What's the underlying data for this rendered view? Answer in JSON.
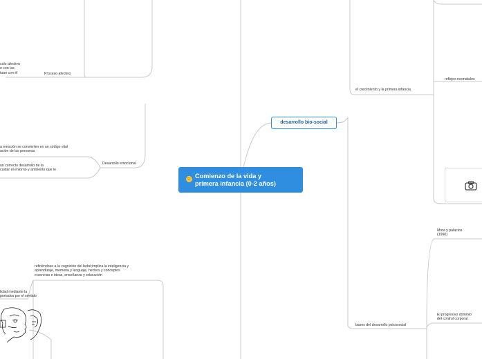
{
  "root": {
    "emoji": "😊",
    "label": "Comienzo de la vida y\nprimera infancia (0-2 años)"
  },
  "branches": {
    "desarrollo_bio_social": {
      "label": "desarrollo bio-social",
      "children": {
        "crecimiento": {
          "label": "el crecimiento y la primera infancia",
          "reflejos": "reflejos neonatales"
        },
        "bases": {
          "label": "bases del desarrollo psicosocial",
          "mora": "Mora y palacios\n (1990)",
          "progresivo": "El progresivo dominio\ndel control corporal"
        }
      }
    },
    "proceso_afectivo": {
      "label": "Proceso afectivo",
      "detail": "culo afectivo\no con las\ntuan con él"
    },
    "desarrollo_emocional": {
      "label": "Desarrollo emocional",
      "detail1": "a emoción se convierten en un código vital\nación de las personas",
      "detail2": "un correcto desarrollo de la\ncuidar el entorno y ambiente que le"
    },
    "cognicion": {
      "label": "refiriéndose a la cognición del bebé;implica la inteligencia y\naprendizaje, memoria y lenguaje, hechos y conceptos\ncreencias e ideas, enseñanza y educación",
      "detail": "lidad mediante la\nportados por el sentido"
    }
  },
  "icons": {
    "camera": "camera-icon",
    "sketch": "face-sketch-image"
  },
  "colors": {
    "root_bg": "#2f8ee0",
    "link": "#c8c8c8",
    "subtopic_border": "#2f8ee0"
  }
}
